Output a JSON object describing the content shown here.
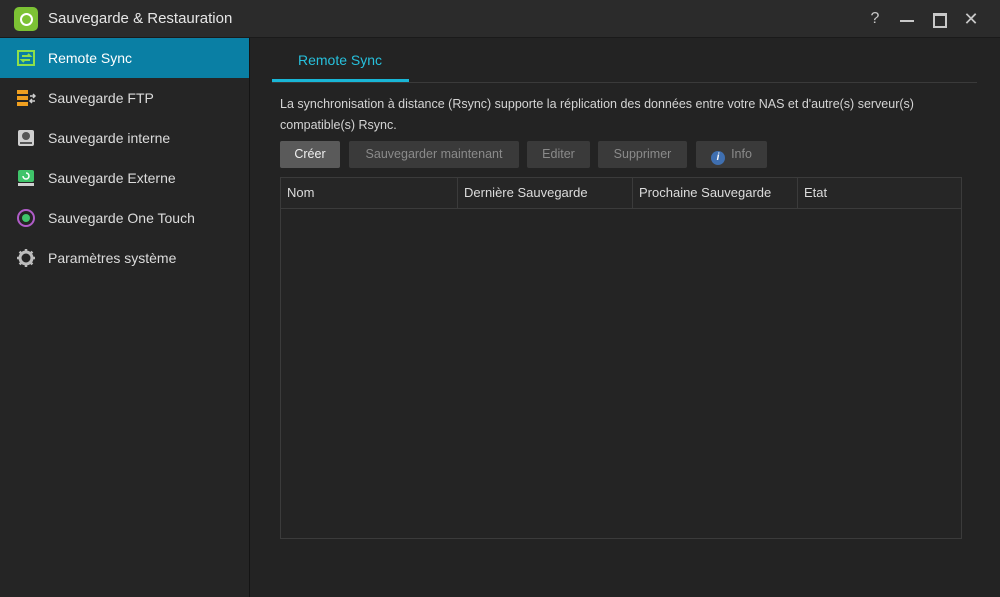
{
  "window": {
    "title": "Sauvegarde & Restauration",
    "controls": {
      "help": "?",
      "close": "✕"
    }
  },
  "sidebar": {
    "items": [
      {
        "label": "Remote Sync",
        "icon": "remote-sync-icon",
        "active": true
      },
      {
        "label": "Sauvegarde FTP",
        "icon": "ftp-server-icon"
      },
      {
        "label": "Sauvegarde interne",
        "icon": "internal-drive-icon"
      },
      {
        "label": "Sauvegarde Externe",
        "icon": "external-drive-icon"
      },
      {
        "label": "Sauvegarde One Touch",
        "icon": "one-touch-icon"
      },
      {
        "label": "Paramètres système",
        "icon": "gear-icon"
      }
    ]
  },
  "main": {
    "tab": "Remote Sync",
    "description": "La synchronisation à distance (Rsync) supporte la réplication des données entre votre NAS et d'autre(s) serveur(s) compatible(s) Rsync.",
    "toolbar": {
      "create": "Créer",
      "backup_now": "Sauvegarder maintenant",
      "edit": "Editer",
      "delete": "Supprimer",
      "info": "Info"
    },
    "table": {
      "columns": [
        "Nom",
        "Dernière Sauvegarde",
        "Prochaine Sauvegarde",
        "Etat"
      ],
      "rows": []
    }
  },
  "colors": {
    "accent": "#0a7fa4",
    "tab_accent": "#19b6d6",
    "background": "#232323",
    "logo": "#7cc234"
  }
}
